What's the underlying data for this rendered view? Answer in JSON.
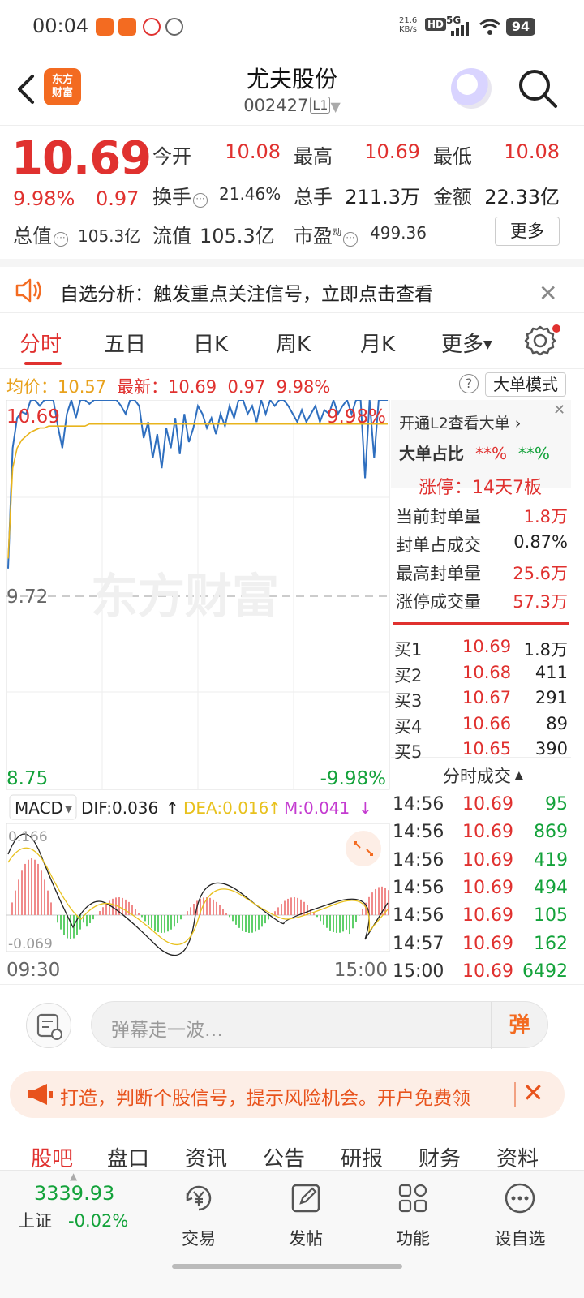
{
  "status_bar": {
    "time": "00:04",
    "net_speed": "21.6 KB/s",
    "signal": "5G",
    "hd": "HD",
    "battery": "94"
  },
  "header": {
    "logo_text": "东方\n财富",
    "stock_name": "尤夫股份",
    "stock_code": "002427",
    "level_badge": "L1"
  },
  "quote": {
    "price": "10.69",
    "change_pct": "9.98%",
    "change_val": "0.97",
    "open_label": "今开",
    "open": "10.08",
    "high_label": "最高",
    "high": "10.69",
    "low_label": "最低",
    "low": "10.08",
    "turnover_label": "换手",
    "turnover": "21.46%",
    "volume_label": "总手",
    "volume": "211.3万",
    "amount_label": "金额",
    "amount": "22.33亿",
    "mcap_label": "总值",
    "mcap": "105.3亿",
    "float_label": "流值",
    "float_cap": "105.3亿",
    "pe_label": "市盈",
    "pe_sup": "动",
    "pe": "499.36",
    "more_btn": "更多"
  },
  "notice": {
    "text": "自选分析：触发重点关注信号，立即点击查看"
  },
  "chart_tabs": [
    "分时",
    "五日",
    "日K",
    "周K",
    "月K",
    "更多"
  ],
  "legend": {
    "avg_label": "均价：",
    "avg": "10.57",
    "latest_label": "最新：",
    "latest": "10.69",
    "latest_chg": "0.97",
    "latest_pct": "9.98%",
    "big_order_btn": "大单模式"
  },
  "chart_axes": {
    "top_price": "10.69",
    "top_pct": "9.98%",
    "mid_price": "9.72",
    "bottom_price": "8.75",
    "bottom_pct": "-9.98%",
    "watermark": "东方财富",
    "macd_label": "MACD",
    "dif": "DIF:0.036",
    "dea": "DEA:0.016",
    "m": "M:0.041",
    "macd_top": "0.166",
    "macd_bottom": "-0.069",
    "time_start": "09:30",
    "time_end": "15:00"
  },
  "chart_data": {
    "type": "line",
    "ylim": [
      8.75,
      10.69
    ],
    "series": [
      {
        "values": [
          9.85,
          10.45,
          10.6,
          10.63,
          10.62,
          10.69,
          10.69,
          10.66,
          10.69,
          10.69,
          10.69,
          10.56,
          10.45,
          10.62,
          10.69,
          10.6,
          10.69,
          10.69,
          10.67,
          10.69,
          10.69,
          10.69,
          10.69,
          10.69,
          10.69,
          10.66,
          10.62,
          10.69,
          10.69,
          10.66,
          10.5,
          10.58,
          10.4,
          10.52,
          10.35,
          10.55,
          10.45,
          10.6,
          10.42,
          10.62,
          10.48,
          10.55,
          10.66,
          10.62,
          10.55,
          10.6,
          10.52,
          10.62,
          10.56,
          10.66,
          10.6,
          10.69,
          10.69,
          10.62,
          10.66,
          10.58,
          10.69,
          10.62,
          10.69,
          10.66,
          10.69,
          10.69,
          10.66,
          10.62,
          10.58,
          10.64,
          10.58,
          10.62,
          10.66,
          10.58,
          10.64,
          10.62,
          10.69,
          10.62,
          10.66,
          10.69,
          10.62,
          10.69,
          10.69,
          10.3,
          10.69,
          10.4,
          10.69,
          10.69,
          10.69
        ]
      },
      {
        "values": [
          9.9,
          10.35,
          10.45,
          10.49,
          10.51,
          10.53,
          10.54,
          10.55,
          10.55,
          10.56,
          10.56,
          10.56,
          10.56,
          10.56,
          10.56,
          10.56,
          10.56,
          10.56,
          10.57,
          10.57,
          10.57,
          10.57,
          10.57,
          10.57,
          10.57,
          10.57,
          10.57,
          10.57,
          10.57,
          10.57,
          10.57,
          10.57,
          10.57,
          10.57,
          10.57,
          10.57,
          10.57,
          10.57,
          10.57,
          10.57,
          10.57,
          10.57,
          10.57,
          10.57,
          10.57,
          10.57,
          10.57,
          10.57,
          10.57,
          10.57,
          10.57,
          10.57,
          10.57,
          10.57,
          10.57,
          10.57,
          10.57,
          10.57,
          10.57,
          10.57,
          10.57,
          10.57,
          10.57,
          10.57,
          10.57,
          10.57,
          10.57,
          10.57,
          10.57,
          10.57,
          10.57,
          10.57,
          10.57,
          10.57,
          10.57,
          10.57,
          10.57,
          10.57,
          10.57,
          10.57,
          10.57,
          10.57,
          10.57,
          10.57,
          10.57
        ]
      }
    ]
  },
  "side_panel": {
    "l2_link": "开通L2查看大单",
    "big_ratio_label": "大单占比",
    "big_ratio_red": "**%",
    "big_ratio_green": "**%",
    "limit_title": "涨停：14天7板",
    "rows": [
      {
        "label": "当前封单量",
        "value": "1.8万"
      },
      {
        "label": "封单占成交",
        "value": "0.87%"
      },
      {
        "label": "最高封单量",
        "value": "25.6万"
      },
      {
        "label": "涨停成交量",
        "value": "57.3万"
      }
    ],
    "bids": [
      {
        "label": "买1",
        "price": "10.69",
        "vol": "1.8万"
      },
      {
        "label": "买2",
        "price": "10.68",
        "vol": "411"
      },
      {
        "label": "买3",
        "price": "10.67",
        "vol": "291"
      },
      {
        "label": "买4",
        "price": "10.66",
        "vol": "89"
      },
      {
        "label": "买5",
        "price": "10.65",
        "vol": "390"
      }
    ],
    "ticks_title": "分时成交",
    "ticks": [
      {
        "time": "14:56",
        "price": "10.69",
        "vol": "95"
      },
      {
        "time": "14:56",
        "price": "10.69",
        "vol": "869"
      },
      {
        "time": "14:56",
        "price": "10.69",
        "vol": "419"
      },
      {
        "time": "14:56",
        "price": "10.69",
        "vol": "494"
      },
      {
        "time": "14:56",
        "price": "10.69",
        "vol": "105"
      },
      {
        "time": "14:57",
        "price": "10.69",
        "vol": "162"
      },
      {
        "time": "15:00",
        "price": "10.69",
        "vol": "6492"
      }
    ]
  },
  "danmu": {
    "placeholder": "弹幕走一波…",
    "send_label": "弹"
  },
  "promo": {
    "text": "打造，判断个股信号，提示风险机会。开户免费领"
  },
  "bottom_tabs": [
    "股吧",
    "盘口",
    "资讯",
    "公告",
    "研报",
    "财务",
    "资料"
  ],
  "bottom_nav": {
    "index_value": "3339.93",
    "index_name": "上证",
    "index_pct": "-0.02%",
    "items": [
      "交易",
      "发帖",
      "功能",
      "设自选"
    ]
  }
}
